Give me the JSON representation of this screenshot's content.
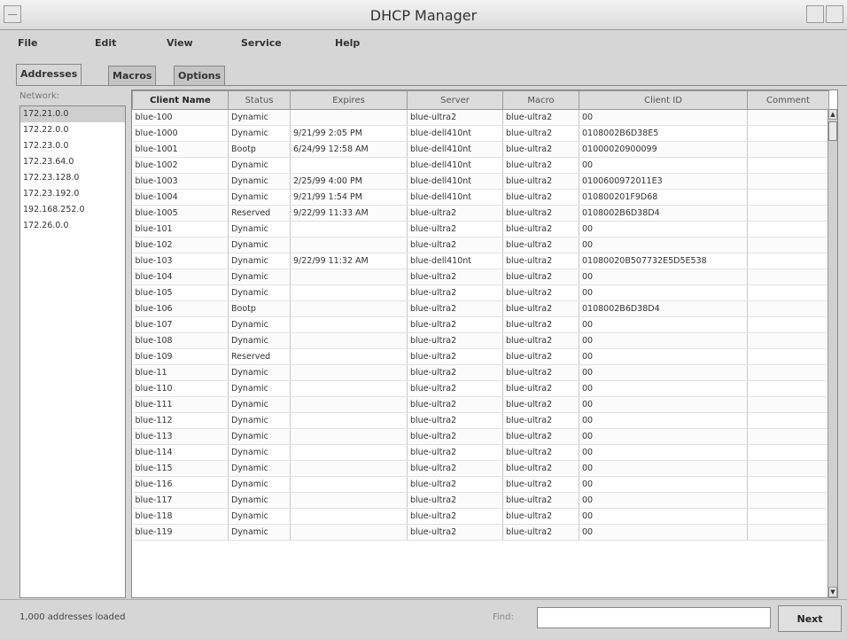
{
  "window": {
    "title": "DHCP Manager"
  },
  "menu": [
    "File",
    "Edit",
    "View",
    "Service",
    "Help"
  ],
  "tabs": [
    "Addresses",
    "Macros",
    "Options"
  ],
  "sidebar": {
    "label": "Network:",
    "networks": [
      "172.21.0.0",
      "172.22.0.0",
      "172.23.0.0",
      "172.23.64.0",
      "172.23.128.0",
      "172.23.192.0",
      "192.168.252.0",
      "172.26.0.0"
    ]
  },
  "table": {
    "columns": [
      "Client Name",
      "Status",
      "Expires",
      "Server",
      "Macro",
      "Client ID",
      "Comment"
    ],
    "rows": [
      [
        "blue-100",
        "Dynamic",
        "",
        "blue-ultra2",
        "blue-ultra2",
        "00",
        ""
      ],
      [
        "blue-1000",
        "Dynamic",
        "9/21/99 2:05 PM",
        "blue-dell410nt",
        "blue-ultra2",
        "0108002B6D38E5",
        ""
      ],
      [
        "blue-1001",
        "Bootp",
        "6/24/99 12:58 AM",
        "blue-dell410nt",
        "blue-ultra2",
        "01000020900099",
        ""
      ],
      [
        "blue-1002",
        "Dynamic",
        "",
        "blue-dell410nt",
        "blue-ultra2",
        "00",
        ""
      ],
      [
        "blue-1003",
        "Dynamic",
        "2/25/99 4:00 PM",
        "blue-dell410nt",
        "blue-ultra2",
        "0100600972011E3",
        ""
      ],
      [
        "blue-1004",
        "Dynamic",
        "9/21/99 1:54 PM",
        "blue-dell410nt",
        "blue-ultra2",
        "010800201F9D68",
        ""
      ],
      [
        "blue-1005",
        "Reserved",
        "9/22/99 11:33 AM",
        "blue-ultra2",
        "blue-ultra2",
        "0108002B6D38D4",
        ""
      ],
      [
        "blue-101",
        "Dynamic",
        "",
        "blue-ultra2",
        "blue-ultra2",
        "00",
        ""
      ],
      [
        "blue-102",
        "Dynamic",
        "",
        "blue-ultra2",
        "blue-ultra2",
        "00",
        ""
      ],
      [
        "blue-103",
        "Dynamic",
        "9/22/99 11:32 AM",
        "blue-dell410nt",
        "blue-ultra2",
        "01080020B507732E5D5E538",
        ""
      ],
      [
        "blue-104",
        "Dynamic",
        "",
        "blue-ultra2",
        "blue-ultra2",
        "00",
        ""
      ],
      [
        "blue-105",
        "Dynamic",
        "",
        "blue-ultra2",
        "blue-ultra2",
        "00",
        ""
      ],
      [
        "blue-106",
        "Bootp",
        "",
        "blue-ultra2",
        "blue-ultra2",
        "0108002B6D38D4",
        ""
      ],
      [
        "blue-107",
        "Dynamic",
        "",
        "blue-ultra2",
        "blue-ultra2",
        "00",
        ""
      ],
      [
        "blue-108",
        "Dynamic",
        "",
        "blue-ultra2",
        "blue-ultra2",
        "00",
        ""
      ],
      [
        "blue-109",
        "Reserved",
        "",
        "blue-ultra2",
        "blue-ultra2",
        "00",
        ""
      ],
      [
        "blue-11",
        "Dynamic",
        "",
        "blue-ultra2",
        "blue-ultra2",
        "00",
        ""
      ],
      [
        "blue-110",
        "Dynamic",
        "",
        "blue-ultra2",
        "blue-ultra2",
        "00",
        ""
      ],
      [
        "blue-111",
        "Dynamic",
        "",
        "blue-ultra2",
        "blue-ultra2",
        "00",
        ""
      ],
      [
        "blue-112",
        "Dynamic",
        "",
        "blue-ultra2",
        "blue-ultra2",
        "00",
        ""
      ],
      [
        "blue-113",
        "Dynamic",
        "",
        "blue-ultra2",
        "blue-ultra2",
        "00",
        ""
      ],
      [
        "blue-114",
        "Dynamic",
        "",
        "blue-ultra2",
        "blue-ultra2",
        "00",
        ""
      ],
      [
        "blue-115",
        "Dynamic",
        "",
        "blue-ultra2",
        "blue-ultra2",
        "00",
        ""
      ],
      [
        "blue-116",
        "Dynamic",
        "",
        "blue-ultra2",
        "blue-ultra2",
        "00",
        ""
      ],
      [
        "blue-117",
        "Dynamic",
        "",
        "blue-ultra2",
        "blue-ultra2",
        "00",
        ""
      ],
      [
        "blue-118",
        "Dynamic",
        "",
        "blue-ultra2",
        "blue-ultra2",
        "00",
        ""
      ],
      [
        "blue-119",
        "Dynamic",
        "",
        "blue-ultra2",
        "blue-ultra2",
        "00",
        ""
      ]
    ]
  },
  "status": {
    "text": "1,000 addresses loaded",
    "find_label": "Find:",
    "find_value": "",
    "next_label": "Next"
  },
  "icons": {
    "window_menu": "window-menu-icon",
    "minimize": "minimize-icon",
    "maximize": "maximize-icon",
    "scroll_up": "scroll-up-arrow-icon",
    "scroll_down": "scroll-down-arrow-icon"
  }
}
